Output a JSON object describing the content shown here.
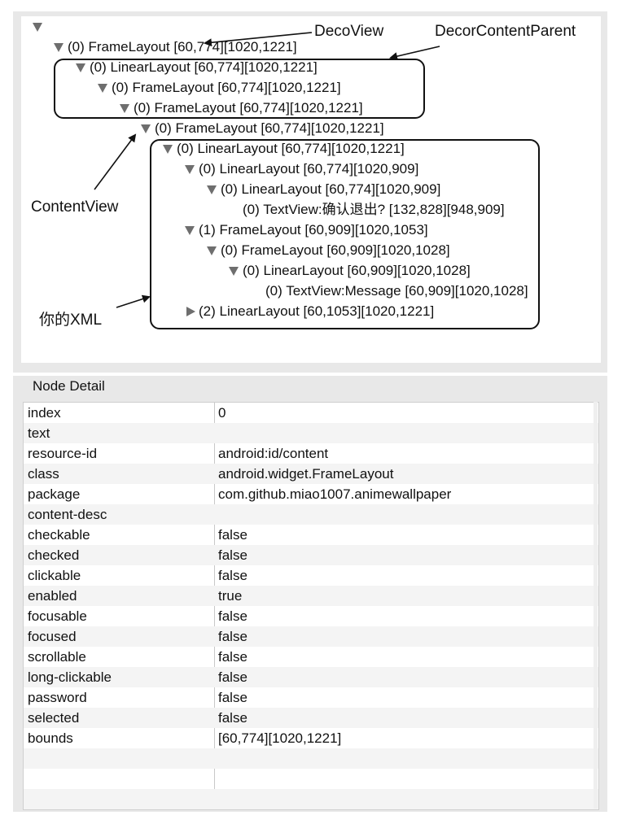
{
  "tree": {
    "nodes": [
      {
        "label": "(0) FrameLayout [60,774][1020,1221]"
      },
      {
        "label": "(0) LinearLayout [60,774][1020,1221]"
      },
      {
        "label": "(0) FrameLayout [60,774][1020,1221]"
      },
      {
        "label": "(0) FrameLayout [60,774][1020,1221]"
      },
      {
        "label": "(0) FrameLayout [60,774][1020,1221]"
      },
      {
        "label": "(0) LinearLayout [60,774][1020,1221]"
      },
      {
        "label": "(0) LinearLayout [60,774][1020,909]"
      },
      {
        "label": "(0) LinearLayout [60,774][1020,909]"
      },
      {
        "label": "(0) TextView:确认退出? [132,828][948,909]"
      },
      {
        "label": "(1) FrameLayout [60,909][1020,1053]"
      },
      {
        "label": "(0) FrameLayout [60,909][1020,1028]"
      },
      {
        "label": "(0) LinearLayout [60,909][1020,1028]"
      },
      {
        "label": "(0) TextView:Message [60,909][1020,1028]"
      },
      {
        "label": "(2) LinearLayout [60,1053][1020,1221]"
      }
    ]
  },
  "annotations": {
    "deco_view": "DecoView",
    "decor_content_parent": "DecorContentParent",
    "content_view": "ContentView",
    "your_xml": "你的XML"
  },
  "detail": {
    "header": "Node Detail",
    "rows": [
      {
        "key": "index",
        "value": "0"
      },
      {
        "key": "text",
        "value": ""
      },
      {
        "key": "resource-id",
        "value": "android:id/content"
      },
      {
        "key": "class",
        "value": "android.widget.FrameLayout"
      },
      {
        "key": "package",
        "value": "com.github.miao1007.animewallpaper"
      },
      {
        "key": "content-desc",
        "value": ""
      },
      {
        "key": "checkable",
        "value": "false"
      },
      {
        "key": "checked",
        "value": "false"
      },
      {
        "key": "clickable",
        "value": "false"
      },
      {
        "key": "enabled",
        "value": "true"
      },
      {
        "key": "focusable",
        "value": "false"
      },
      {
        "key": "focused",
        "value": "false"
      },
      {
        "key": "scrollable",
        "value": "false"
      },
      {
        "key": "long-clickable",
        "value": "false"
      },
      {
        "key": "password",
        "value": "false"
      },
      {
        "key": "selected",
        "value": "false"
      },
      {
        "key": "bounds",
        "value": "[60,774][1020,1221]"
      }
    ]
  },
  "colors": {
    "panel_bg": "#e8e8e8",
    "expander": "#6e6e6e",
    "annotation": "#111111"
  }
}
